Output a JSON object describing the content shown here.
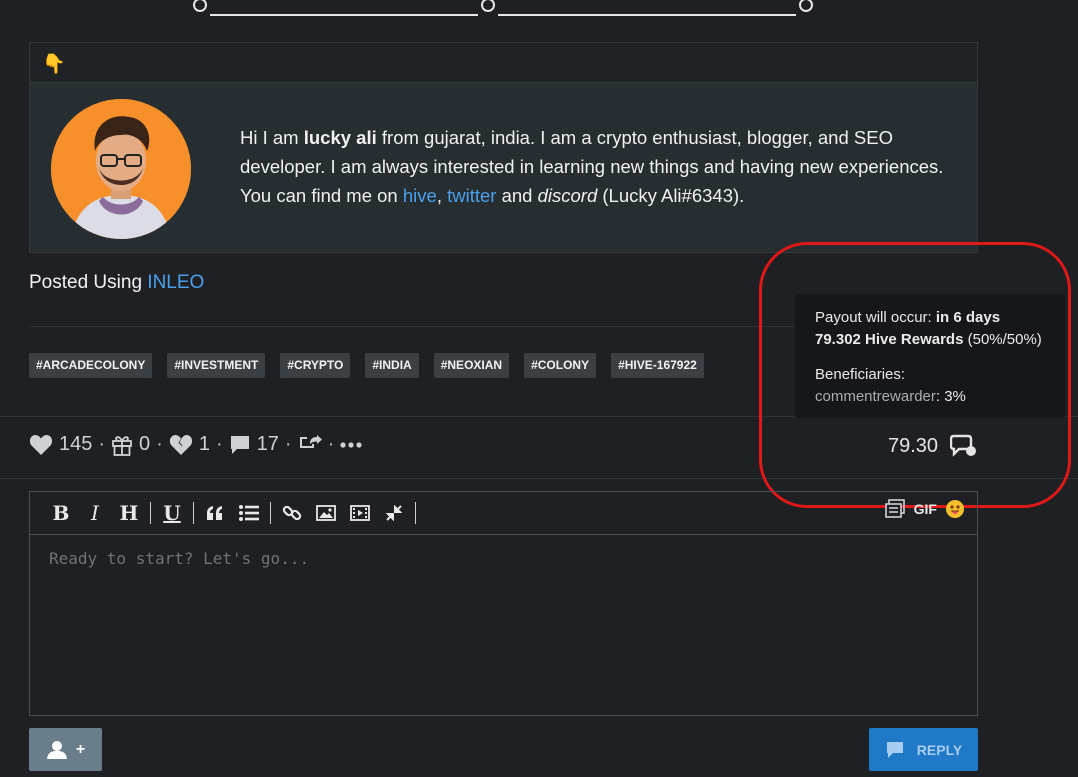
{
  "card": {
    "header_emoji": "👇",
    "bio": {
      "p1": "Hi I am ",
      "name": "lucky ali",
      "p2": " from gujarat, india. I am a crypto enthusiast, blogger, and SEO developer. I am always interested in learning new things and having new experiences. You can find me on ",
      "link_hive": "hive",
      "comma": ", ",
      "link_twitter": "twitter",
      "p3": " and ",
      "discord": "discord",
      "p4": " (Lucky Ali#6343)."
    }
  },
  "posted": {
    "prefix": "Posted Using ",
    "link": "INLEO"
  },
  "tags": [
    "#ARCADECOLONY",
    "#INVESTMENT",
    "#CRYPTO",
    "#INDIA",
    "#NEOXIAN",
    "#COLONY",
    "#HIVE-167922"
  ],
  "actions": {
    "votes": "145",
    "gifts": "0",
    "downvotes": "1",
    "comments": "17",
    "separator": "·"
  },
  "payout": {
    "value": "79.30",
    "tooltip": {
      "occur_label": "Payout will occur: ",
      "occur_value": "in 6 days",
      "rewards": "79.302 Hive Rewards",
      "rewards_split": " (50%/50%)",
      "beneficiaries_label": "Beneficiaries:",
      "beneficiary_name": "commentrewarder",
      "beneficiary_pct": ": 3%"
    }
  },
  "editor": {
    "toolbar": {
      "bold": "B",
      "italic": "I",
      "heading": "H",
      "underline": "U",
      "gif": "GIF"
    },
    "placeholder": "Ready to start? Let's go..."
  },
  "buttons": {
    "beneficiary_plus": "+",
    "reply": "REPLY"
  },
  "colors": {
    "link": "#4aa0ec",
    "reply_bg": "#2079c7",
    "annotation": "#e01818"
  }
}
